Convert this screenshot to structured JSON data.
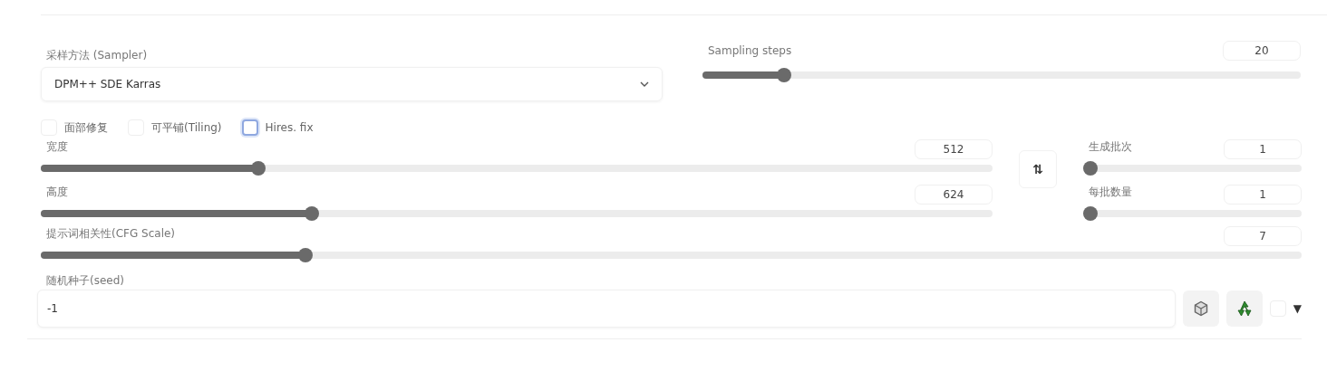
{
  "sampler": {
    "label": "采样方法 (Sampler)",
    "value": "DPM++ SDE Karras"
  },
  "sampling_steps": {
    "label": "Sampling steps",
    "value": "20",
    "level": 0.136
  },
  "options": [
    {
      "label": "面部修复",
      "checked": false,
      "kind": "plain"
    },
    {
      "label": "可平铺(Tiling)",
      "checked": false,
      "kind": "plain"
    },
    {
      "label": "Hires. fix",
      "checked": false,
      "kind": "focused"
    }
  ],
  "size_sliders": [
    {
      "label": "宽度",
      "value": "512",
      "level": 0.229
    },
    {
      "label": "高度",
      "value": "624",
      "level": 0.285
    }
  ],
  "swap_button": {
    "label": "⇅"
  },
  "batch_sliders": [
    {
      "label": "生成批次",
      "value": "1",
      "level": 0
    },
    {
      "label": "每批数量",
      "value": "1",
      "level": 0
    }
  ],
  "cfg_scale": {
    "label": "提示词相关性(CFG Scale)",
    "value": "7",
    "level": 0.21
  },
  "seed": {
    "label": "随机种子(seed)",
    "value": "-1",
    "extra_checked": false,
    "extra_toggle": "▼"
  }
}
